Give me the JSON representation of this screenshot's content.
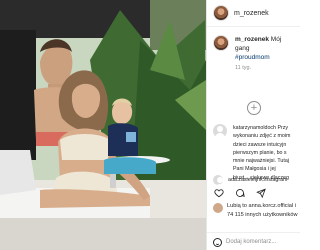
{
  "post": {
    "username": "m_rozenek",
    "caption_user": "m_rozenek",
    "caption_text": "Mój gang",
    "hashtag": "#proudmom",
    "caption_time": "11 tyg.",
    "comment1": {
      "lines": [
        "katarzynamoldoch Przy",
        "wykonaniu zdjęć z moim",
        "dzieci zawsze intuicyjn",
        "pierwszym planie, bo s",
        "mnie najważniejsi. Tutaj",
        "Pani Małgosia i jej",
        "biust... ciekawe dlaczeg"
      ]
    },
    "comment2_user": "ada.zasieleijnk.instagram",
    "likes_line1": "Lubią to anna.korcz.official i",
    "likes_line2": "74 115 innych użytkowników",
    "date": "12 LISTOPADA",
    "add_comment_placeholder": "Dodaj komentarz..."
  },
  "icons": {
    "heart": "heart-icon",
    "comment": "comment-icon",
    "share": "share-icon",
    "bookmark": "bookmark-icon",
    "plus": "plus-icon",
    "emoji": "emoji-icon"
  }
}
